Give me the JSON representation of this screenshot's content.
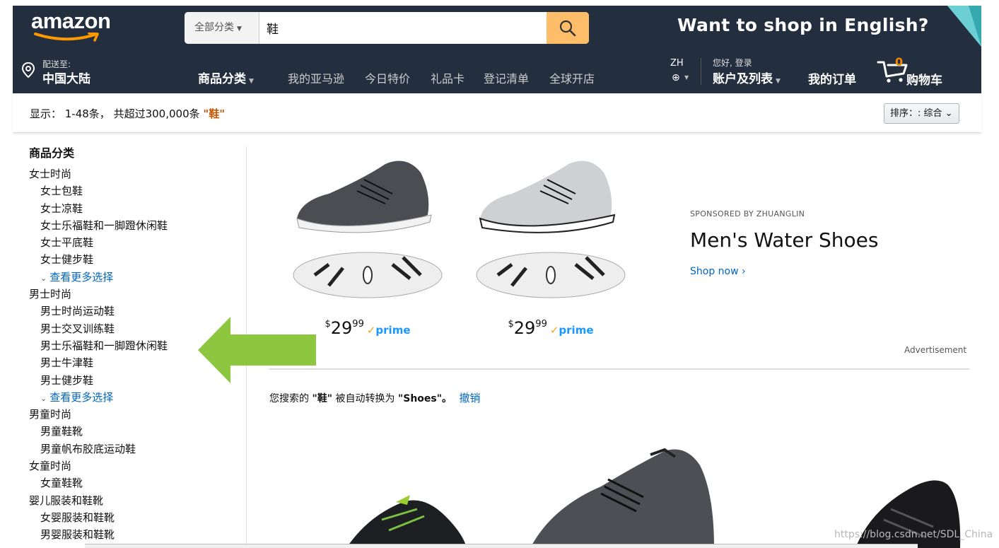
{
  "header": {
    "logo_text": "amazon",
    "search": {
      "category": "全部分类",
      "query": "鞋"
    },
    "promo_text": "Want to shop in English?",
    "deliver": {
      "line1": "配送至:",
      "line2": "中国大陆"
    },
    "nav": {
      "categories": "商品分类",
      "links": [
        "我的亚马逊",
        "今日特价",
        "礼品卡",
        "登记清单",
        "全球开店"
      ]
    },
    "lang": "ZH",
    "account": {
      "line1": "您好, 登录",
      "line2": "账户及列表"
    },
    "orders": "我的订单",
    "cart": {
      "count": "0",
      "label": "购物车"
    }
  },
  "results": {
    "summary": "显示： 1-48条， 共超过300,000条",
    "query": "\"鞋\"",
    "sort": "排序：: 综合"
  },
  "sidebar": {
    "heading": "商品分类",
    "items": [
      {
        "label": "女士时尚",
        "level": 0
      },
      {
        "label": "女士包鞋",
        "level": 1
      },
      {
        "label": "女士凉鞋",
        "level": 1
      },
      {
        "label": "女士乐福鞋和一脚蹬休闲鞋",
        "level": 1
      },
      {
        "label": "女士平底鞋",
        "level": 1
      },
      {
        "label": "女士健步鞋",
        "level": 1
      },
      {
        "label": "查看更多选择",
        "level": "more"
      },
      {
        "label": "男士时尚",
        "level": 0
      },
      {
        "label": "男士时尚运动鞋",
        "level": 1
      },
      {
        "label": "男士交叉训练鞋",
        "level": 1
      },
      {
        "label": "男士乐福鞋和一脚蹬休闲鞋",
        "level": 1
      },
      {
        "label": "男士牛津鞋",
        "level": 1
      },
      {
        "label": "男士健步鞋",
        "level": 1
      },
      {
        "label": "查看更多选择",
        "level": "more"
      },
      {
        "label": "男童时尚",
        "level": 0
      },
      {
        "label": "男童鞋靴",
        "level": 1
      },
      {
        "label": "男童帆布胶底运动鞋",
        "level": 1
      },
      {
        "label": "女童时尚",
        "level": 0
      },
      {
        "label": "女童鞋靴",
        "level": 1
      },
      {
        "label": "婴儿服装和鞋靴",
        "level": 0
      },
      {
        "label": "女婴服装和鞋靴",
        "level": 1
      },
      {
        "label": "男婴服装和鞋靴",
        "level": 1
      }
    ]
  },
  "ad": {
    "products": [
      {
        "price_whole": "29",
        "price_fraction": "99",
        "currency": "$",
        "badge": "prime",
        "shoe_color": "dark-gray"
      },
      {
        "price_whole": "29",
        "price_fraction": "99",
        "currency": "$",
        "badge": "prime",
        "shoe_color": "light-gray"
      }
    ],
    "sponsor": "SPONSORED BY ZHUANGLIN",
    "title": "Men's Water Shoes",
    "cta": "Shop now ›",
    "label": "Advertisement"
  },
  "spelling": {
    "prefix": "您搜索的",
    "original": "\"鞋\"",
    "middle": "被自动转换为",
    "converted": "\"Shoes\"。",
    "undo": "撤销"
  },
  "watermark": "https://blog.csdn.net/SDL_China",
  "colors": {
    "nav_bg": "#232f3e",
    "search_btn": "#febd69",
    "link": "#0066c0",
    "query_highlight": "#c45500",
    "annotation_arrow": "#8dc63f"
  }
}
